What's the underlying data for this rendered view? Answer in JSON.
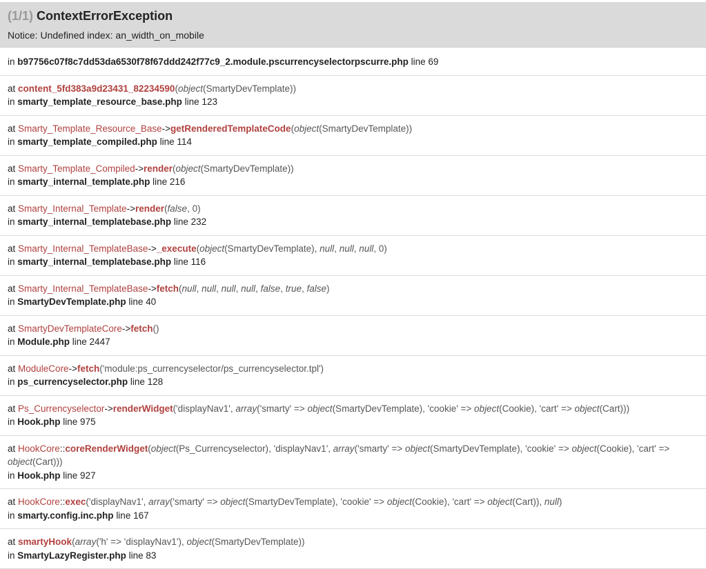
{
  "header": {
    "count": "(1/1)",
    "exception": "ContextErrorException",
    "message": "Notice: Undefined index: an_width_on_mobile"
  },
  "location": {
    "file": "b97756c07f8c7dd53da6530f78f67ddd242f77c9_2.module.pscurrencyselectorpscurre.php",
    "line": "line 69"
  },
  "frames": [
    {
      "class": "",
      "sep": "",
      "function": "content_5fd383a9d23431_82234590",
      "args": [
        [
          "obj",
          "SmartyDevTemplate"
        ]
      ],
      "file": "smarty_template_resource_base.php",
      "line": "line 123"
    },
    {
      "class": "Smarty_Template_Resource_Base",
      "sep": "->",
      "function": "getRenderedTemplateCode",
      "args": [
        [
          "obj",
          "SmartyDevTemplate"
        ]
      ],
      "file": "smarty_template_compiled.php",
      "line": "line 114"
    },
    {
      "class": "Smarty_Template_Compiled",
      "sep": "->",
      "function": "render",
      "args": [
        [
          "obj",
          "SmartyDevTemplate"
        ]
      ],
      "file": "smarty_internal_template.php",
      "line": "line 216"
    },
    {
      "class": "Smarty_Internal_Template",
      "sep": "->",
      "function": "render",
      "args": [
        [
          "it",
          "false"
        ],
        [
          "txt",
          "0"
        ]
      ],
      "file": "smarty_internal_templatebase.php",
      "line": "line 232"
    },
    {
      "class": "Smarty_Internal_TemplateBase",
      "sep": "->",
      "function": "_execute",
      "args": [
        [
          "obj",
          "SmartyDevTemplate"
        ],
        [
          "it",
          "null"
        ],
        [
          "it",
          "null"
        ],
        [
          "it",
          "null"
        ],
        [
          "txt",
          "0"
        ]
      ],
      "file": "smarty_internal_templatebase.php",
      "line": "line 116"
    },
    {
      "class": "Smarty_Internal_TemplateBase",
      "sep": "->",
      "function": "fetch",
      "args": [
        [
          "it",
          "null"
        ],
        [
          "it",
          "null"
        ],
        [
          "it",
          "null"
        ],
        [
          "it",
          "null"
        ],
        [
          "it",
          "false"
        ],
        [
          "it",
          "true"
        ],
        [
          "it",
          "false"
        ]
      ],
      "file": "SmartyDevTemplate.php",
      "line": "line 40"
    },
    {
      "class": "SmartyDevTemplateCore",
      "sep": "->",
      "function": "fetch",
      "args": [],
      "file": "Module.php",
      "line": "line 2447"
    },
    {
      "class": "ModuleCore",
      "sep": "->",
      "function": "fetch",
      "args": [
        [
          "txt",
          "'module:ps_currencyselector/ps_currencyselector.tpl'"
        ]
      ],
      "file": "ps_currencyselector.php",
      "line": "line 128"
    },
    {
      "class": "Ps_Currencyselector",
      "sep": "->",
      "function": "renderWidget",
      "args": [
        [
          "txt",
          "'displayNav1'"
        ],
        [
          "arr",
          "'smarty' => |object|(SmartyDevTemplate), 'cookie' => |object|(Cookie), 'cart' => |object|(Cart)"
        ]
      ],
      "file": "Hook.php",
      "line": "line 975"
    },
    {
      "class": "HookCore",
      "sep": "::",
      "function": "coreRenderWidget",
      "args": [
        [
          "obj",
          "Ps_Currencyselector"
        ],
        [
          "txt",
          "'displayNav1'"
        ],
        [
          "arr",
          "'smarty' => |object|(SmartyDevTemplate), 'cookie' => |object|(Cookie), 'cart' => |object|(Cart)"
        ]
      ],
      "file": "Hook.php",
      "line": "line 927"
    },
    {
      "class": "HookCore",
      "sep": "::",
      "function": "exec",
      "args": [
        [
          "txt",
          "'displayNav1'"
        ],
        [
          "arr",
          "'smarty' => |object|(SmartyDevTemplate), 'cookie' => |object|(Cookie), 'cart' => |object|(Cart)"
        ],
        [
          "it",
          "null"
        ]
      ],
      "file": "smarty.config.inc.php",
      "line": "line 167"
    },
    {
      "class": "",
      "sep": "",
      "function": "smartyHook",
      "args": [
        [
          "arr",
          "'h' => 'displayNav1'"
        ],
        [
          "obj",
          "SmartyDevTemplate"
        ]
      ],
      "file": "SmartyLazyRegister.php",
      "line": "line 83"
    }
  ],
  "labels": {
    "at": "at",
    "in": "in",
    "object": "object",
    "array": "array"
  },
  "colors": {
    "header_bg": "#dadada",
    "class_red": "#b0413e",
    "divider": "#dcdcdc"
  }
}
